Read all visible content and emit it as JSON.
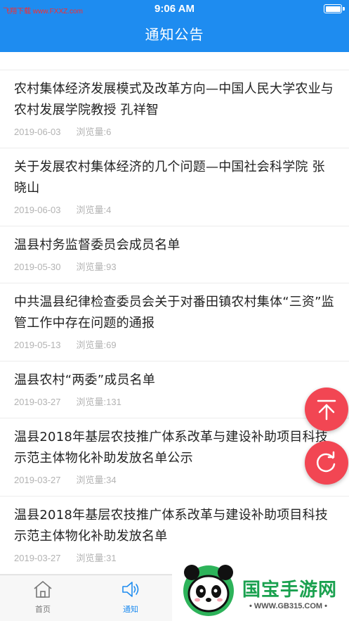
{
  "status_bar": {
    "left_text": "飞翔下载 www.FXXZ.com",
    "time": "9:06 AM"
  },
  "nav": {
    "title": "通知公告"
  },
  "items": [
    {
      "title": "农村集体经济发展模式及改革方向—中国人民大学农业与农村发展学院教授 孔祥智",
      "date": "2019-06-03",
      "views": "浏览量:6"
    },
    {
      "title": "关于发展农村集体经济的几个问题—中国社会科学院 张晓山",
      "date": "2019-06-03",
      "views": "浏览量:4"
    },
    {
      "title": "温县村务监督委员会成员名单",
      "date": "2019-05-30",
      "views": "浏览量:93"
    },
    {
      "title": "中共温县纪律检查委员会关于对番田镇农村集体“三资”监管工作中存在问题的通报",
      "date": "2019-05-13",
      "views": "浏览量:69"
    },
    {
      "title": "温县农村“两委”成员名单",
      "date": "2019-03-27",
      "views": "浏览量:131"
    },
    {
      "title": "温县2018年基层农技推广体系改革与建设补助项目科技示范主体物化补助发放名单公示",
      "date": "2019-03-27",
      "views": "浏览量:34"
    },
    {
      "title": "温县2018年基层农技推广体系改革与建设补助项目科技示范主体物化补助发放名单",
      "date": "2019-03-27",
      "views": "浏览量:31"
    }
  ],
  "fab": {
    "top_icon": "arrow-up-to-top-icon",
    "refresh_icon": "refresh-icon"
  },
  "tabs": [
    {
      "label": "首页",
      "icon": "home-icon",
      "active": false
    },
    {
      "label": "通知",
      "icon": "speaker-icon",
      "active": true
    }
  ],
  "watermark": {
    "text": "国宝手游网",
    "url": "• WWW.GB315.COM •",
    "logo": "panda-logo"
  },
  "colors": {
    "primary": "#1E8CF0",
    "fab": "#F24653",
    "meta": "#B3B3B3"
  }
}
